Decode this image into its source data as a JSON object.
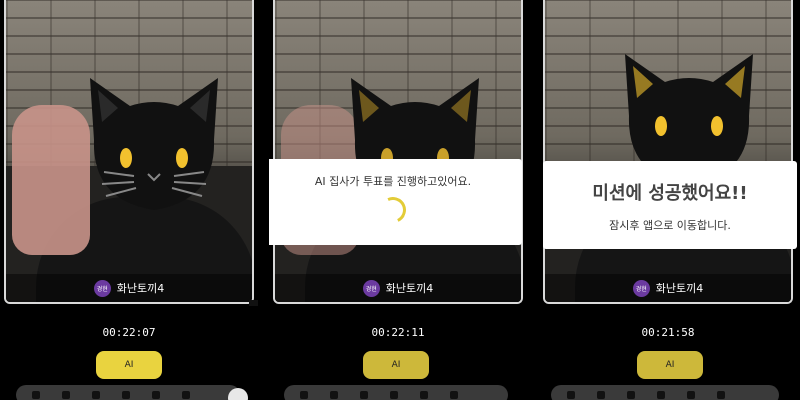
{
  "panels": [
    {
      "participant": {
        "badge": "경현",
        "name": "화난토끼4"
      },
      "timer": "00:22:07",
      "ai_label": "AI"
    },
    {
      "participant": {
        "badge": "경현",
        "name": "화난토끼4"
      },
      "timer": "00:22:11",
      "ai_label": "AI",
      "dialog": {
        "message": "AI 집사가 투표를 진행하고있어요."
      }
    },
    {
      "participant": {
        "badge": "경현",
        "name": "화난토끼4"
      },
      "timer": "00:21:58",
      "ai_label": "AI",
      "dialog": {
        "title": "미션에 성공했어요!!",
        "message": "잠시후 앱으로 이동합니다."
      }
    }
  ],
  "colors": {
    "accent": "#e9d33f",
    "badge": "#6b3aa0",
    "cat": "#111111",
    "cat_eyes": "#f2c12e"
  },
  "icons": [
    "cat-mask-icon",
    "spinner-icon"
  ]
}
